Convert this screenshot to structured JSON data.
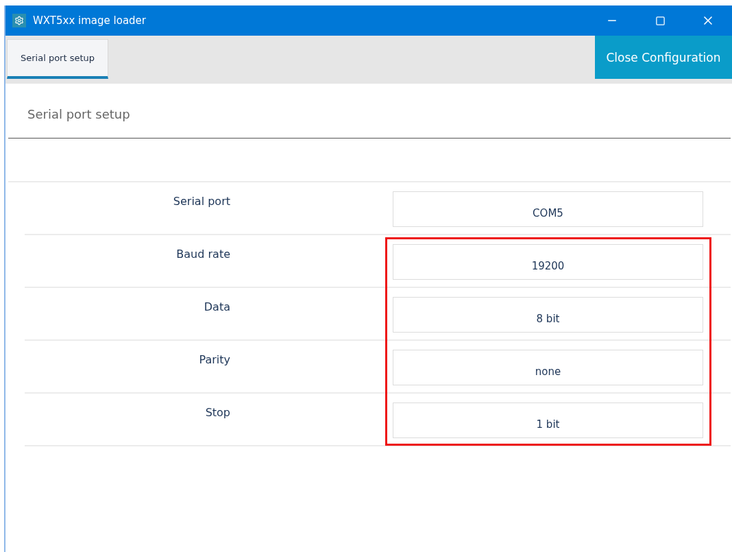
{
  "window": {
    "title": "WXT5xx image loader"
  },
  "tabs": [
    {
      "label": "Serial port setup",
      "selected": true
    }
  ],
  "close_button": "Close Configuration",
  "section_title": "Serial port setup",
  "rows": [
    {
      "label": "Serial port",
      "value": "COM5",
      "highlighted": false
    },
    {
      "label": "Baud rate",
      "value": "19200",
      "highlighted": true
    },
    {
      "label": "Data",
      "value": "8 bit",
      "highlighted": true
    },
    {
      "label": "Parity",
      "value": "none",
      "highlighted": true
    },
    {
      "label": "Stop",
      "value": "1 bit",
      "highlighted": true
    }
  ]
}
